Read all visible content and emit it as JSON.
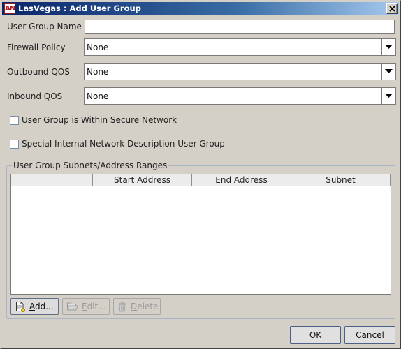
{
  "window": {
    "title": "LasVegas : Add User Group",
    "icon": "app-logo-icon",
    "icon_text": "AN",
    "close_icon": "close-icon"
  },
  "form": {
    "group_name": {
      "label": "User Group Name",
      "value": ""
    },
    "firewall_policy": {
      "label": "Firewall Policy",
      "selected": "None"
    },
    "outbound_qos": {
      "label": "Outbound QOS",
      "selected": "None"
    },
    "inbound_qos": {
      "label": "Inbound QOS",
      "selected": "None"
    },
    "secure_network": {
      "label": "User Group is Within Secure Network",
      "checked": false
    },
    "special_internal": {
      "label": "Special Internal Network Description User Group",
      "checked": false
    }
  },
  "subnets": {
    "group_title": "User Group Subnets/Address Ranges",
    "columns": [
      "",
      "Start Address",
      "End Address",
      "Subnet"
    ],
    "rows": [],
    "buttons": {
      "add": {
        "mnemonic": "A",
        "rest": "dd...",
        "icon": "add-document-icon",
        "enabled": true
      },
      "edit": {
        "mnemonic": "E",
        "rest": "dit...",
        "icon": "open-folder-icon",
        "enabled": false
      },
      "delete": {
        "mnemonic": "D",
        "rest": "elete",
        "icon": "trash-icon",
        "enabled": false
      }
    }
  },
  "dialog_buttons": {
    "ok": {
      "mnemonic": "O",
      "rest": "K"
    },
    "cancel": {
      "mnemonic": "C",
      "rest": "ancel"
    }
  }
}
